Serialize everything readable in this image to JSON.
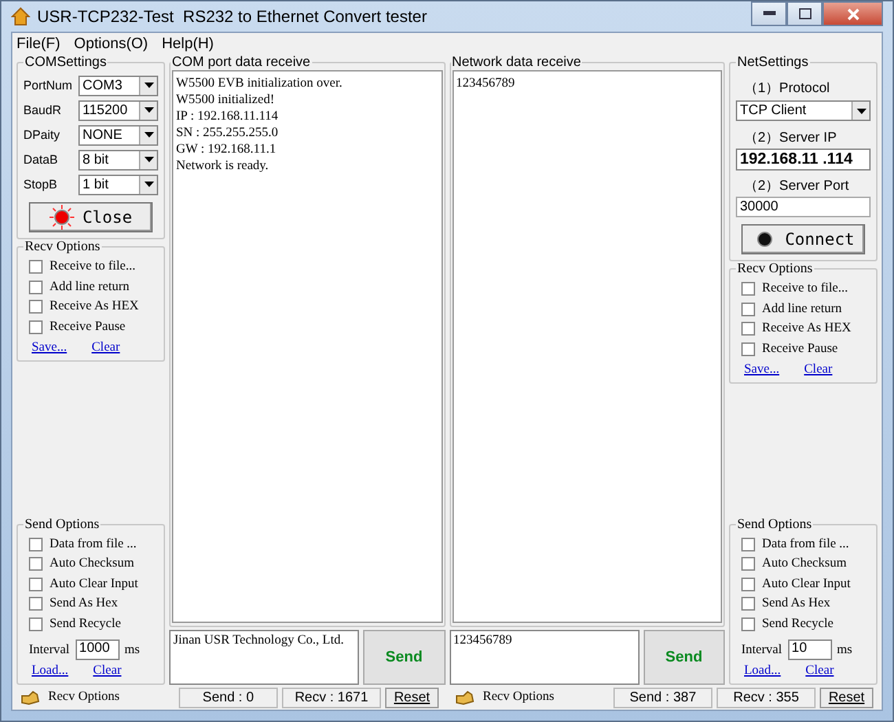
{
  "window": {
    "title": "USR-TCP232-Test  RS232 to Ethernet Convert tester"
  },
  "menu": [
    "File(F)",
    "Options(O)",
    "Help(H)"
  ],
  "com_settings": {
    "title": "COMSettings",
    "fields": [
      {
        "label": "PortNum",
        "value": "COM3"
      },
      {
        "label": "BaudR",
        "value": "115200"
      },
      {
        "label": "DPaity",
        "value": "NONE"
      },
      {
        "label": "DataB",
        "value": "8 bit"
      },
      {
        "label": "StopB",
        "value": "1 bit"
      }
    ],
    "button": {
      "label": "Close",
      "active": true
    }
  },
  "net_settings": {
    "title": "NetSettings",
    "protocol_label": "（1）Protocol",
    "protocol": "TCP Client",
    "ip_label": "（2）Server IP",
    "ip": "192.168.11 .114",
    "port_label": "（2）Server Port",
    "port": "30000",
    "button": {
      "label": "Connect",
      "active": false
    }
  },
  "sides": [
    {
      "recv_options": {
        "title": "Recv Options",
        "options": [
          {
            "label": "Receive to file...",
            "checked": false
          },
          {
            "label": "Add line return",
            "checked": false
          },
          {
            "label": "Receive As HEX",
            "checked": false
          },
          {
            "label": "Receive Pause",
            "checked": false
          }
        ],
        "links": [
          "Save...",
          "Clear"
        ]
      },
      "send_options": {
        "title": "Send Options",
        "options": [
          {
            "label": "Data from file ...",
            "checked": false
          },
          {
            "label": "Auto Checksum",
            "checked": false
          },
          {
            "label": "Auto Clear Input",
            "checked": false
          },
          {
            "label": "Send As Hex",
            "checked": false
          },
          {
            "label": "Send Recycle",
            "checked": false
          }
        ],
        "interval_label": "Interval",
        "interval": "1000",
        "unit": "ms",
        "links": [
          "Load...",
          "Clear"
        ]
      },
      "receive": {
        "title": "COM port data receive",
        "lines": [
          "W5500 EVB initialization over.",
          "W5500 initialized!",
          "IP : 192.168.11.114",
          "SN : 255.255.255.0",
          "GW : 192.168.11.1",
          "Network is ready."
        ]
      },
      "send": {
        "text": "Jinan USR Technology Co., Ltd.",
        "button": "Send"
      },
      "status": {
        "label": "Recv Options",
        "send": "Send : 0",
        "recv": "Recv : 1671",
        "reset": "Reset"
      }
    },
    {
      "recv_options": {
        "title": "Recv Options",
        "options": [
          {
            "label": "Receive to file...",
            "checked": false
          },
          {
            "label": "Add line return",
            "checked": false
          },
          {
            "label": "Receive As HEX",
            "checked": false
          },
          {
            "label": "Receive Pause",
            "checked": false
          }
        ],
        "links": [
          "Save...",
          "Clear"
        ]
      },
      "send_options": {
        "title": "Send Options",
        "options": [
          {
            "label": "Data from file ...",
            "checked": false
          },
          {
            "label": "Auto Checksum",
            "checked": false
          },
          {
            "label": "Auto Clear Input",
            "checked": false
          },
          {
            "label": "Send As Hex",
            "checked": false
          },
          {
            "label": "Send Recycle",
            "checked": false
          }
        ],
        "interval_label": "Interval",
        "interval": "10",
        "unit": "ms",
        "links": [
          "Load...",
          "Clear"
        ]
      },
      "receive": {
        "title": "Network data receive",
        "lines": [
          "123456789"
        ]
      },
      "send": {
        "text": "123456789",
        "button": "Send"
      },
      "status": {
        "label": "Recv Options",
        "send": "Send : 387",
        "recv": "Recv : 355",
        "reset": "Reset"
      }
    }
  ]
}
